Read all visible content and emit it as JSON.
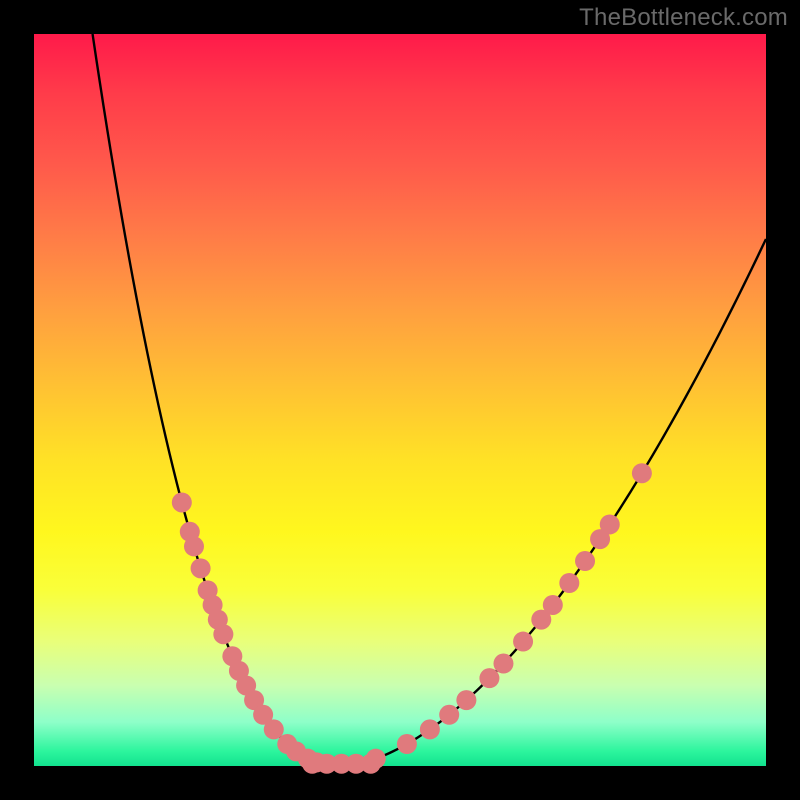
{
  "watermark": "TheBottleneck.com",
  "chart_data": {
    "type": "line",
    "title": "",
    "xlabel": "",
    "ylabel": "",
    "xlim": [
      0,
      100
    ],
    "ylim": [
      0,
      100
    ],
    "gradient_top_color": "#ff1a4a",
    "gradient_bottom_color": "#12e28f",
    "curve": {
      "description": "V-shaped bottleneck curve, steep descent from top-left, minimum near x≈42, shallower rise to upper-right",
      "left_branch": {
        "x_range": [
          8,
          42
        ],
        "y_range": [
          100,
          0
        ]
      },
      "right_branch": {
        "x_range": [
          42,
          100
        ],
        "y_range": [
          0,
          72
        ]
      },
      "minimum_x": 42,
      "minimum_y": 0
    },
    "markers": {
      "color": "#e07a7d",
      "radius_px": 10,
      "left_cluster_y_pct": [
        36,
        32,
        30,
        27,
        24,
        22,
        20,
        18,
        15,
        13,
        11,
        9,
        7,
        5,
        3,
        2,
        1,
        0.5
      ],
      "flat_cluster_x_pct": [
        38,
        40,
        42,
        44,
        46
      ],
      "right_cluster_y_pct": [
        1,
        3,
        5,
        7,
        9,
        12,
        14,
        17,
        20,
        22,
        25,
        28,
        31,
        33,
        40
      ]
    }
  }
}
